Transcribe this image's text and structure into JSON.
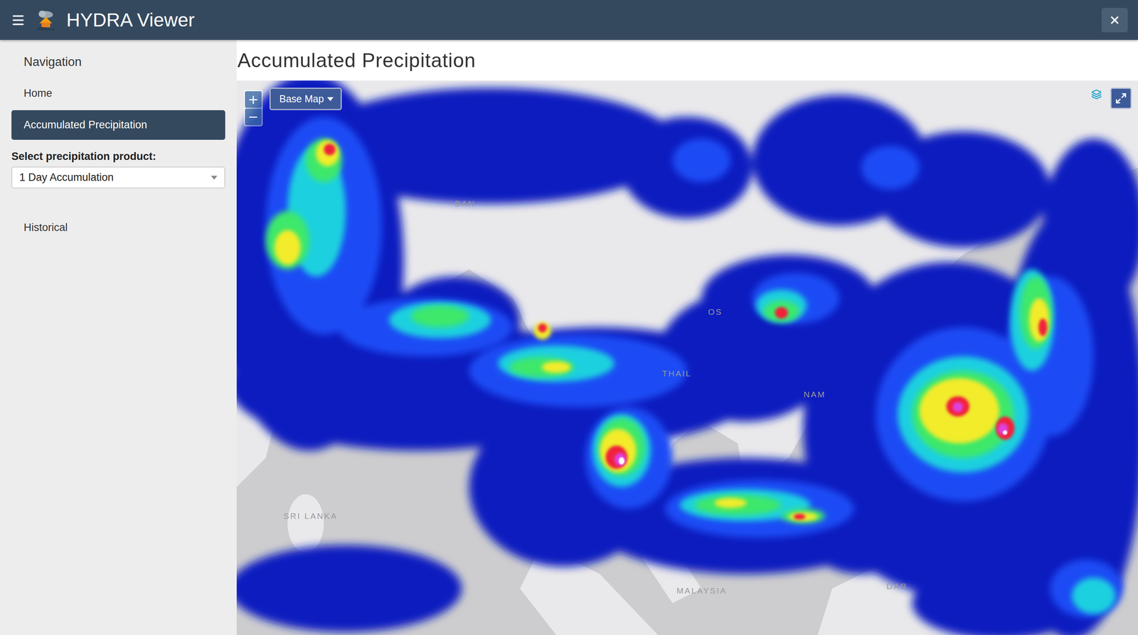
{
  "header": {
    "title": "HYDRA Viewer"
  },
  "sidebar": {
    "heading": "Navigation",
    "items": [
      {
        "label": "Home",
        "selected": false
      },
      {
        "label": "Accumulated Precipitation",
        "selected": true
      }
    ],
    "product_label": "Select precipitation product:",
    "product_value": "1 Day Accumulation",
    "footer_items": [
      {
        "label": "Historical",
        "selected": false
      }
    ]
  },
  "page": {
    "title": "Accumulated Precipitation"
  },
  "map": {
    "controls": {
      "zoom_in": "+",
      "zoom_out": "−",
      "base_map": "Base Map"
    },
    "labels": [
      {
        "text": "BAN"
      },
      {
        "text": "OS"
      },
      {
        "text": "THAIL"
      },
      {
        "text": "NAM"
      },
      {
        "text": "SRI LANKA"
      },
      {
        "text": "MALAYSIA"
      },
      {
        "text": "DAR"
      }
    ]
  }
}
